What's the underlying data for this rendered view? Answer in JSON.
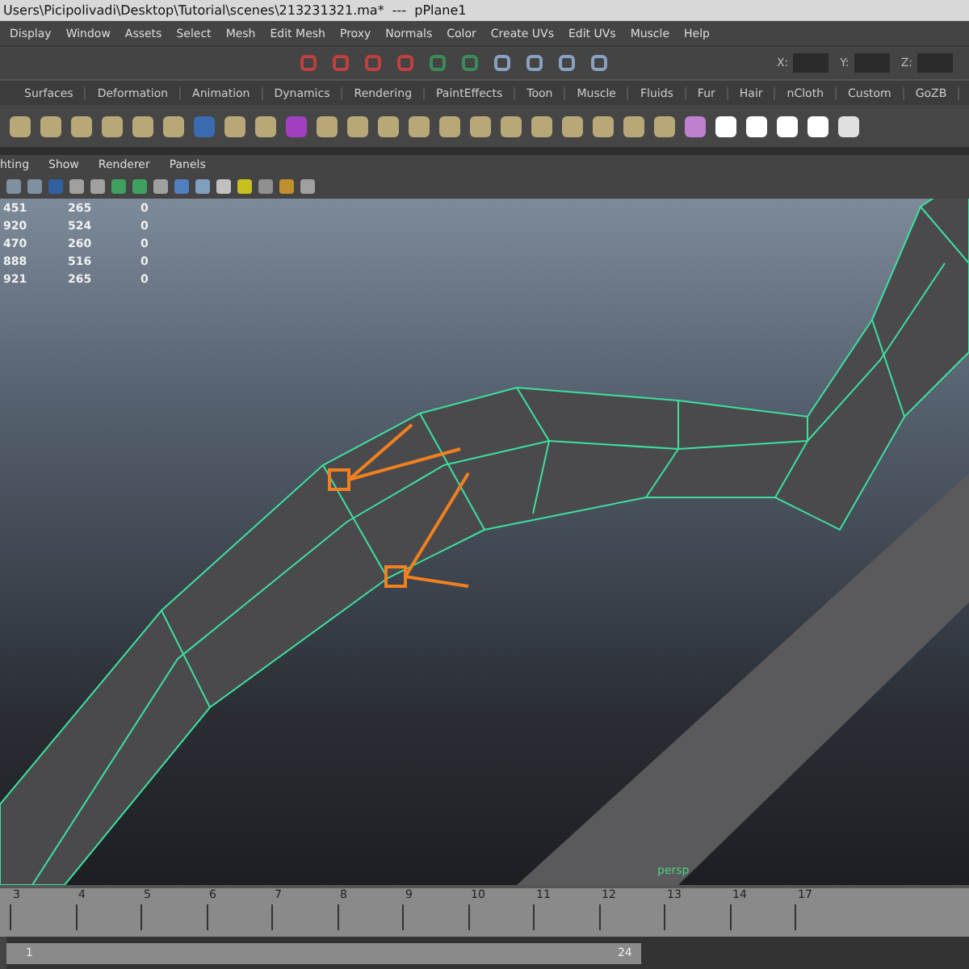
{
  "window": {
    "title": "Users\\Picipolivadi\\Desktop\\Tutorial\\scenes\\213231321.ma*  ---  pPlane1"
  },
  "menu_bar": [
    "Display",
    "Window",
    "Assets",
    "Select",
    "Mesh",
    "Edit Mesh",
    "Proxy",
    "Normals",
    "Color",
    "Create UVs",
    "Edit UVs",
    "Muscle",
    "Help"
  ],
  "status_line": {
    "fields": [
      {
        "label": "X:"
      },
      {
        "label": "Y:"
      },
      {
        "label": "Z:"
      }
    ]
  },
  "shelf_tabs": [
    "Surfaces",
    "Deformation",
    "Animation",
    "Dynamics",
    "Rendering",
    "PaintEffects",
    "Toon",
    "Muscle",
    "Fluids",
    "Fur",
    "Hair",
    "nCloth",
    "Custom",
    "GoZB"
  ],
  "panel_menu": [
    "hting",
    "Show",
    "Renderer",
    "Panels"
  ],
  "hud_rows": [
    [
      "451",
      "265",
      "0"
    ],
    [
      "920",
      "524",
      "0"
    ],
    [
      "470",
      "260",
      "0"
    ],
    [
      "888",
      "516",
      "0"
    ],
    [
      "921",
      "265",
      "0"
    ]
  ],
  "viewport": {
    "camera": "persp"
  },
  "time_slider": {
    "ticks": [
      "3",
      "4",
      "5",
      "6",
      "7",
      "8",
      "9",
      "10",
      "11",
      "12",
      "13",
      "14",
      "17"
    ]
  },
  "range_slider": {
    "start": "1",
    "end": "24",
    "level": 0.66
  }
}
